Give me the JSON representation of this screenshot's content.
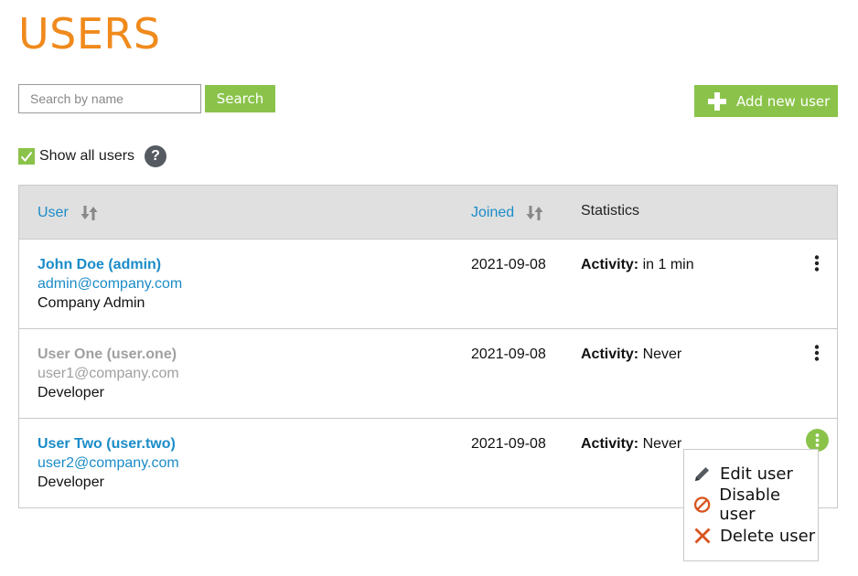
{
  "page": {
    "title": "USERS"
  },
  "search": {
    "placeholder": "Search by name",
    "value": "",
    "button_label": "Search"
  },
  "add_user": {
    "label": "Add new user"
  },
  "filter": {
    "show_all_label": "Show all users",
    "show_all_checked": true,
    "help_symbol": "?"
  },
  "table": {
    "headers": {
      "user": "User",
      "joined": "Joined",
      "statistics": "Statistics"
    },
    "activity_label": "Activity:",
    "rows": [
      {
        "name": "John Doe (admin)",
        "email": "admin@company.com",
        "role": "Company Admin",
        "joined": "2021-09-08",
        "activity": "in 1 min",
        "disabled": false
      },
      {
        "name": "User One (user.one)",
        "email": "user1@company.com",
        "role": "Developer",
        "joined": "2021-09-08",
        "activity": "Never",
        "disabled": true
      },
      {
        "name": "User Two (user.two)",
        "email": "user2@company.com",
        "role": "Developer",
        "joined": "2021-09-08",
        "activity": "Never",
        "disabled": false
      }
    ]
  },
  "context_menu": {
    "items": [
      {
        "label": "Edit user",
        "icon": "pencil-icon"
      },
      {
        "label": "Disable user",
        "icon": "prohibited-icon"
      },
      {
        "label": "Delete user",
        "icon": "x-icon"
      }
    ]
  },
  "colors": {
    "accent_orange": "#f08a1c",
    "accent_green": "#8bc34a",
    "link_blue": "#1a8cc8",
    "danger_red": "#d9531e"
  }
}
